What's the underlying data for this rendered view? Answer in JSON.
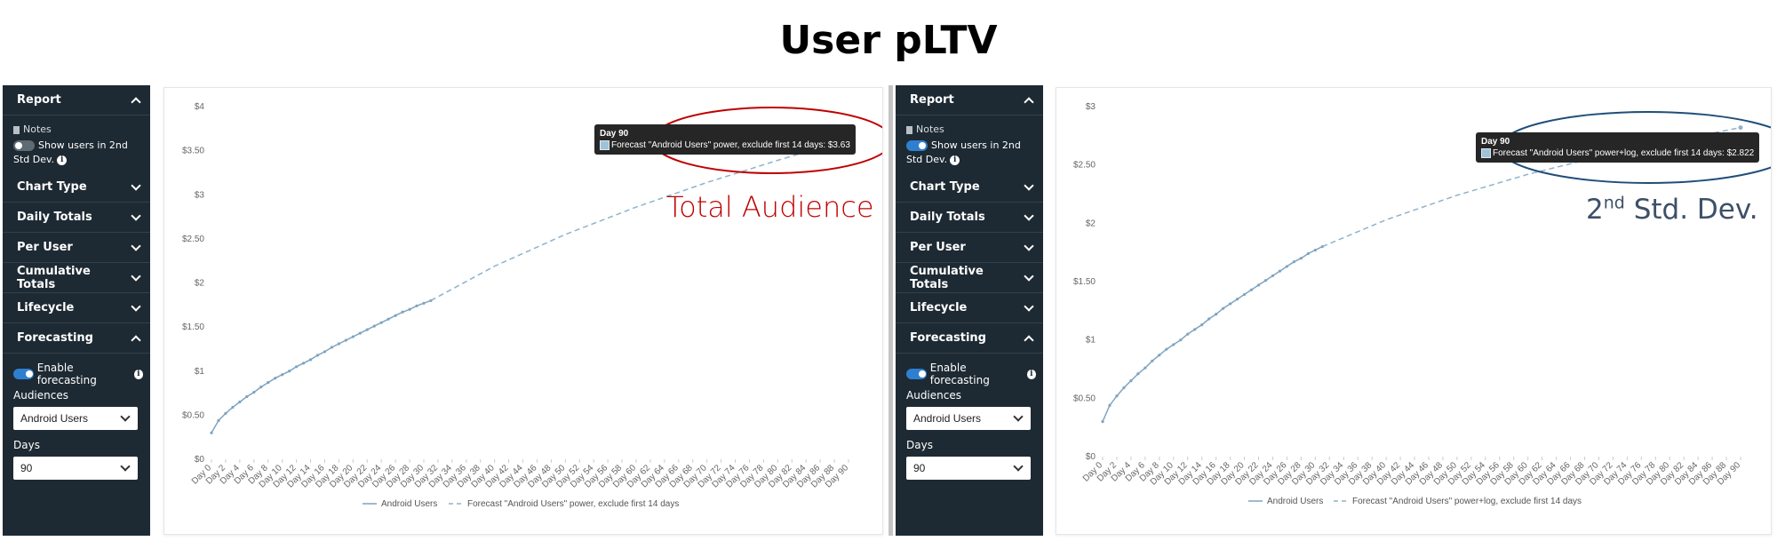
{
  "page_title": "User pLTV",
  "colors": {
    "sidebar_bg": "#1e2a33",
    "forecast_line": "#8eb3cc",
    "actual_line": "#7ea4c0",
    "red_annotation": "#c00000",
    "blue_annotation": "#1f4e79"
  },
  "sidebar": {
    "report_label": "Report",
    "notes_label": "Notes",
    "show_users_label": "Show users in 2nd Std Dev.",
    "sections": [
      "Chart Type",
      "Daily Totals",
      "Per User",
      "Cumulative Totals",
      "Lifecycle"
    ],
    "forecasting_label": "Forecasting",
    "enable_forecasting_label": "Enable forecasting",
    "audiences_label": "Audiences",
    "audiences_value": "Android Users",
    "days_label": "Days",
    "days_value": "90"
  },
  "annotations": {
    "total_audience": "Total Audience",
    "std_dev_number": "2",
    "std_dev_suffix": "nd",
    "std_dev_text": " Std. Dev."
  },
  "charts": {
    "left": {
      "tooltip_title": "Day 90",
      "tooltip_text": "Forecast \"Android Users\" power, exclude first 14 days: $3.63",
      "legend_actual": "Android Users",
      "legend_forecast": "Forecast \"Android Users\" power, exclude first 14 days"
    },
    "right": {
      "tooltip_title": "Day 90",
      "tooltip_text": "Forecast \"Android Users\" power+log, exclude first 14 days: $2.822",
      "legend_actual": "Android Users",
      "legend_forecast": "Forecast \"Android Users\" power+log, exclude first 14 days"
    }
  },
  "chart_data": [
    {
      "type": "line",
      "title": "",
      "x_ticks": [
        "Day 0",
        "Day 2",
        "Day 4",
        "Day 6",
        "Day 8",
        "Day 10",
        "Day 12",
        "Day 14",
        "Day 16",
        "Day 18",
        "Day 20",
        "Day 22",
        "Day 24",
        "Day 26",
        "Day 28",
        "Day 30",
        "Day 32",
        "Day 34",
        "Day 36",
        "Day 38",
        "Day 40",
        "Day 42",
        "Day 44",
        "Day 46",
        "Day 48",
        "Day 50",
        "Day 52",
        "Day 54",
        "Day 56",
        "Day 58",
        "Day 60",
        "Day 62",
        "Day 64",
        "Day 66",
        "Day 68",
        "Day 70",
        "Day 72",
        "Day 74",
        "Day 76",
        "Day 78",
        "Day 80",
        "Day 82",
        "Day 84",
        "Day 86",
        "Day 88",
        "Day 90"
      ],
      "y_ticks": [
        "$0",
        "$0.50",
        "$1",
        "$1.50",
        "$2",
        "$2.50",
        "$3",
        "$3.50",
        "$4"
      ],
      "ylim": [
        0,
        4
      ],
      "xlim": [
        0,
        90
      ],
      "grid": false,
      "legend_position": "bottom",
      "series": [
        {
          "name": "Android Users",
          "style": "solid",
          "x": [
            0,
            1,
            2,
            3,
            4,
            5,
            6,
            7,
            8,
            9,
            10,
            11,
            12,
            13,
            14,
            15,
            16,
            17,
            18,
            19,
            20,
            21,
            22,
            23,
            24,
            25,
            26,
            27,
            28,
            29,
            30,
            31
          ],
          "values": [
            0.3,
            0.44,
            0.52,
            0.59,
            0.65,
            0.71,
            0.76,
            0.82,
            0.87,
            0.92,
            0.96,
            1.0,
            1.05,
            1.09,
            1.13,
            1.18,
            1.22,
            1.27,
            1.31,
            1.35,
            1.39,
            1.43,
            1.47,
            1.51,
            1.55,
            1.59,
            1.63,
            1.67,
            1.7,
            1.74,
            1.77,
            1.8
          ]
        },
        {
          "name": "Forecast \"Android Users\" power, exclude first 14 days",
          "style": "dashed",
          "x": [
            31,
            40,
            50,
            60,
            70,
            80,
            90
          ],
          "values": [
            1.8,
            2.19,
            2.55,
            2.86,
            3.14,
            3.39,
            3.63
          ]
        }
      ]
    },
    {
      "type": "line",
      "title": "",
      "x_ticks": [
        "Day 0",
        "Day 2",
        "Day 4",
        "Day 6",
        "Day 8",
        "Day 10",
        "Day 12",
        "Day 14",
        "Day 16",
        "Day 18",
        "Day 20",
        "Day 22",
        "Day 24",
        "Day 26",
        "Day 28",
        "Day 30",
        "Day 32",
        "Day 34",
        "Day 36",
        "Day 38",
        "Day 40",
        "Day 42",
        "Day 44",
        "Day 46",
        "Day 48",
        "Day 50",
        "Day 52",
        "Day 54",
        "Day 56",
        "Day 58",
        "Day 60",
        "Day 62",
        "Day 64",
        "Day 66",
        "Day 68",
        "Day 70",
        "Day 72",
        "Day 74",
        "Day 76",
        "Day 78",
        "Day 80",
        "Day 82",
        "Day 84",
        "Day 86",
        "Day 88",
        "Day 90"
      ],
      "y_ticks": [
        "$0",
        "$0.50",
        "$1",
        "$1.50",
        "$2",
        "$2.50",
        "$3"
      ],
      "ylim": [
        0,
        3
      ],
      "xlim": [
        0,
        90
      ],
      "grid": false,
      "legend_position": "bottom",
      "series": [
        {
          "name": "Android Users",
          "style": "solid",
          "x": [
            0,
            1,
            2,
            3,
            4,
            5,
            6,
            7,
            8,
            9,
            10,
            11,
            12,
            13,
            14,
            15,
            16,
            17,
            18,
            19,
            20,
            21,
            22,
            23,
            24,
            25,
            26,
            27,
            28,
            29,
            30,
            31
          ],
          "values": [
            0.3,
            0.44,
            0.52,
            0.59,
            0.65,
            0.71,
            0.76,
            0.82,
            0.87,
            0.92,
            0.96,
            1.0,
            1.05,
            1.09,
            1.13,
            1.18,
            1.22,
            1.27,
            1.31,
            1.35,
            1.39,
            1.43,
            1.47,
            1.51,
            1.55,
            1.59,
            1.63,
            1.67,
            1.7,
            1.74,
            1.77,
            1.8
          ]
        },
        {
          "name": "Forecast \"Android Users\" power+log, exclude first 14 days",
          "style": "dashed",
          "x": [
            31,
            40,
            50,
            60,
            70,
            80,
            90
          ],
          "values": [
            1.8,
            2.03,
            2.24,
            2.42,
            2.57,
            2.7,
            2.82
          ]
        }
      ]
    }
  ]
}
